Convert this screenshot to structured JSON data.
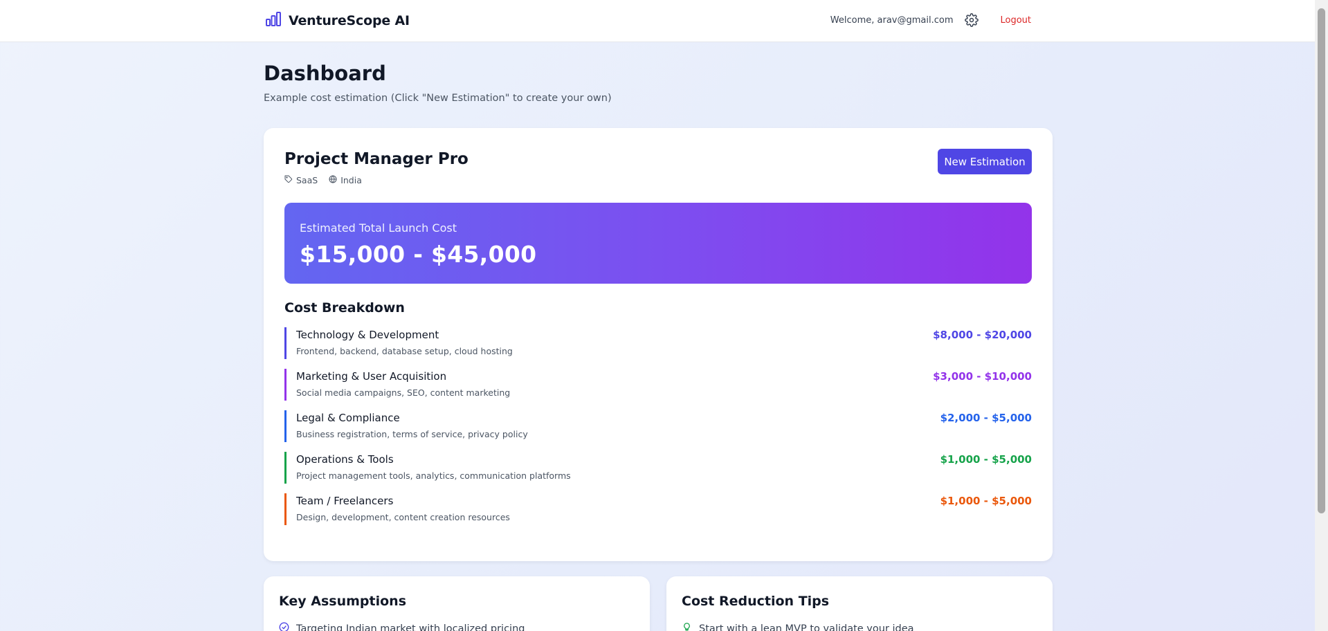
{
  "header": {
    "brand": "VentureScope AI",
    "welcome": "Welcome, arav@gmail.com",
    "logout": "Logout"
  },
  "page": {
    "title": "Dashboard",
    "subtitle": "Example cost estimation (Click \"New Estimation\" to create your own)"
  },
  "project": {
    "name": "Project Manager Pro",
    "category": "SaaS",
    "market": "India",
    "new_button": "New Estimation",
    "total_label": "Estimated Total Launch Cost",
    "total_value": "$15,000 - $45,000"
  },
  "breakdown": {
    "title": "Cost Breakdown",
    "items": [
      {
        "name": "Technology & Development",
        "desc": "Frontend, backend, database setup, cloud hosting",
        "amount": "$8,000 - $20,000",
        "color": "#4f46e5"
      },
      {
        "name": "Marketing & User Acquisition",
        "desc": "Social media campaigns, SEO, content marketing",
        "amount": "$3,000 - $10,000",
        "color": "#9333ea"
      },
      {
        "name": "Legal & Compliance",
        "desc": "Business registration, terms of service, privacy policy",
        "amount": "$2,000 - $5,000",
        "color": "#2563eb"
      },
      {
        "name": "Operations & Tools",
        "desc": "Project management tools, analytics, communication platforms",
        "amount": "$1,000 - $5,000",
        "color": "#16a34a"
      },
      {
        "name": "Team / Freelancers",
        "desc": "Design, development, content creation resources",
        "amount": "$1,000 - $5,000",
        "color": "#ea580c"
      }
    ]
  },
  "assumptions": {
    "title": "Key Assumptions",
    "first_item": "Targeting Indian market with localized pricing"
  },
  "tips": {
    "title": "Cost Reduction Tips",
    "first_item": "Start with a lean MVP to validate your idea"
  },
  "colors": {
    "brand": "#4f46e5",
    "logout": "#dc2626",
    "gradient_start": "#6366f1",
    "gradient_end": "#9333ea"
  },
  "icons": {
    "logo": "bar-chart-icon",
    "settings": "gear-icon",
    "category": "tag-icon",
    "market": "globe-icon",
    "assumption": "check-circle-icon",
    "tip": "lightbulb-icon"
  }
}
